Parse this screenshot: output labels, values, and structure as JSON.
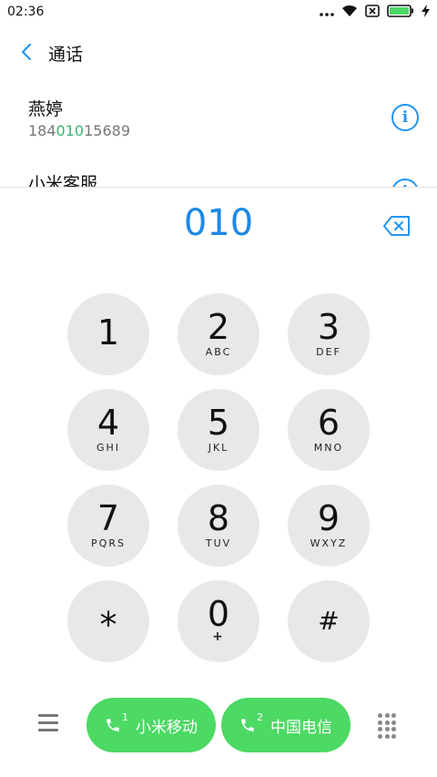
{
  "status_bar": {
    "time": "02:36",
    "icons": [
      "more-dots-icon",
      "wifi-icon",
      "no-sim-icon",
      "battery-icon",
      "charging-icon"
    ],
    "battery_color": "#4cd964"
  },
  "header": {
    "back_icon": "chevron-left-icon",
    "title": "通话"
  },
  "results": [
    {
      "name": "燕婷",
      "number_before": "184",
      "number_match": "010",
      "number_after": "15689"
    },
    {
      "name": "小米客服",
      "number_before": "",
      "number_match": "",
      "number_after": ""
    }
  ],
  "dialer": {
    "entered_number": "010",
    "backspace_icon": "backspace-icon"
  },
  "keypad": [
    {
      "digit": "1",
      "letters": ""
    },
    {
      "digit": "2",
      "letters": "ABC"
    },
    {
      "digit": "3",
      "letters": "DEF"
    },
    {
      "digit": "4",
      "letters": "GHI"
    },
    {
      "digit": "5",
      "letters": "JKL"
    },
    {
      "digit": "6",
      "letters": "MNO"
    },
    {
      "digit": "7",
      "letters": "PQRS"
    },
    {
      "digit": "8",
      "letters": "TUV"
    },
    {
      "digit": "9",
      "letters": "WXYZ"
    },
    {
      "digit": "*",
      "letters": ""
    },
    {
      "digit": "0",
      "letters": "+"
    },
    {
      "digit": "#",
      "letters": ""
    }
  ],
  "bottom_bar": {
    "menu_icon": "menu-icon",
    "sim1": {
      "slot": "1",
      "label": "小米移动"
    },
    "sim2": {
      "slot": "2",
      "label": "中国电信"
    },
    "keypad_toggle_icon": "dialpad-icon"
  },
  "colors": {
    "accent": "#1e88e5",
    "info": "#2196f3",
    "call_green": "#4cd964",
    "match_green": "#3cb371",
    "key_bg": "#e8e8e8"
  }
}
